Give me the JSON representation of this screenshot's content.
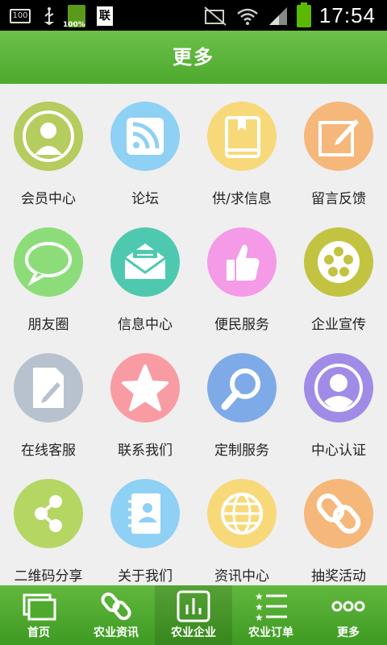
{
  "statusbar": {
    "box_text": "100",
    "battery_small_text": "100%",
    "doc_text": "联",
    "time": "17:54"
  },
  "header": {
    "title": "更多"
  },
  "grid": {
    "items": [
      {
        "label": "会员中心",
        "icon": "person-icon",
        "color": "#b5cc5e"
      },
      {
        "label": "论坛",
        "icon": "rss-icon",
        "color": "#8fd0f5"
      },
      {
        "label": "供/求信息",
        "icon": "book-icon",
        "color": "#f7d97a"
      },
      {
        "label": "留言反馈",
        "icon": "edit-icon",
        "color": "#f6b77a"
      },
      {
        "label": "朋友圈",
        "icon": "chat-bubble-icon",
        "color": "#8cdd7a"
      },
      {
        "label": "信息中心",
        "icon": "envelope-icon",
        "color": "#4ec9b0"
      },
      {
        "label": "便民服务",
        "icon": "thumbs-up-icon",
        "color": "#f59ae6"
      },
      {
        "label": "企业宣传",
        "icon": "film-reel-icon",
        "color": "#c2c441"
      },
      {
        "label": "在线客服",
        "icon": "document-pen-icon",
        "color": "#b8c2ce"
      },
      {
        "label": "联系我们",
        "icon": "star-icon",
        "color": "#f99ba3"
      },
      {
        "label": "定制服务",
        "icon": "magnifier-icon",
        "color": "#7eaae8"
      },
      {
        "label": "中心认证",
        "icon": "user-badge-icon",
        "color": "#a08ce6"
      },
      {
        "label": "二维码分享",
        "icon": "share-icon",
        "color": "#b6d664"
      },
      {
        "label": "关于我们",
        "icon": "contacts-book-icon",
        "color": "#8fd0f5"
      },
      {
        "label": "资讯中心",
        "icon": "globe-icon",
        "color": "#f7d97a"
      },
      {
        "label": "抽奖活动",
        "icon": "link-icon",
        "color": "#f6b77a"
      }
    ]
  },
  "bottomnav": {
    "items": [
      {
        "label": "首页",
        "icon": "windows-icon"
      },
      {
        "label": "农业资讯",
        "icon": "link-icon"
      },
      {
        "label": "农业企业",
        "icon": "bar-chart-icon"
      },
      {
        "label": "农业订单",
        "icon": "star-list-icon"
      },
      {
        "label": "更多",
        "icon": "more-dots-icon"
      }
    ],
    "active_index": 2
  }
}
